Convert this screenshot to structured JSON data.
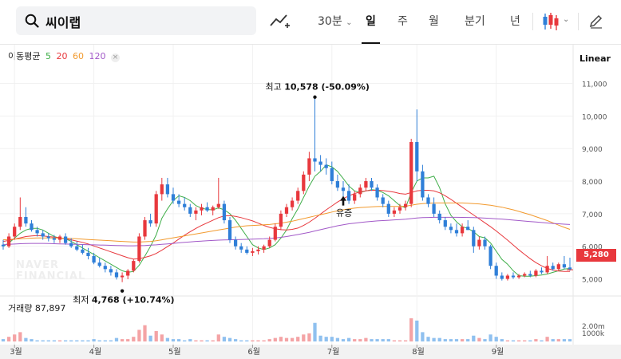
{
  "search": {
    "query": "씨이랩",
    "icon": "search-icon"
  },
  "toolbar": {
    "compare_icon": "line-chart-add-icon",
    "interval_label": "30분",
    "tabs": [
      "일",
      "주",
      "월",
      "분기",
      "년"
    ],
    "active_tab": "일",
    "candle_icon": "candlestick-icon",
    "draw_icon": "pencil-icon"
  },
  "ma_legend": {
    "label": "이동평균",
    "items": [
      {
        "period": "5",
        "color": "#3fae49"
      },
      {
        "period": "20",
        "color": "#e8383d"
      },
      {
        "period": "60",
        "color": "#f29a2e"
      },
      {
        "period": "120",
        "color": "#a259c8"
      }
    ],
    "close_icon": "close-icon"
  },
  "scale_label": "Linear",
  "annotations": {
    "high": {
      "label": "최고",
      "value": "10,578",
      "change": "(-50.09%)"
    },
    "low": {
      "label": "최저",
      "value": "4,768",
      "change": "(+10.74%)"
    },
    "event": "유증"
  },
  "current_price": "5,280",
  "watermark": [
    "NAVER",
    "FINANCIAL"
  ],
  "volume": {
    "label": "거래량",
    "value": "87,897",
    "ticks": [
      "2.00m",
      "1000k"
    ]
  },
  "chart_data": {
    "type": "candlestick",
    "y_ticks": [
      "11,000",
      "10,000",
      "9,000",
      "8,000",
      "7,000",
      "6,000",
      "5,000"
    ],
    "ylim": [
      4500,
      11600
    ],
    "x_labels": [
      "3월",
      "4월",
      "5월",
      "6월",
      "7월",
      "8월",
      "9월"
    ],
    "grid": true,
    "colors": {
      "up": "#e8383d",
      "down": "#2f7fd8"
    },
    "ohlc": [
      [
        6050,
        6200,
        5900,
        6000
      ],
      [
        6000,
        6400,
        5950,
        6300
      ],
      [
        6300,
        6700,
        6200,
        6600
      ],
      [
        6600,
        7500,
        6500,
        6900
      ],
      [
        6900,
        7200,
        6600,
        6700
      ],
      [
        6700,
        6800,
        6450,
        6500
      ],
      [
        6500,
        6600,
        6300,
        6400
      ],
      [
        6400,
        6500,
        6200,
        6300
      ],
      [
        6300,
        6400,
        6150,
        6250
      ],
      [
        6250,
        6350,
        6100,
        6200
      ],
      [
        6200,
        6350,
        6100,
        6300
      ],
      [
        6300,
        6400,
        6050,
        6100
      ],
      [
        6100,
        6250,
        5950,
        6000
      ],
      [
        6000,
        6150,
        5850,
        5900
      ],
      [
        5900,
        6050,
        5750,
        5800
      ],
      [
        5800,
        5950,
        5600,
        5700
      ],
      [
        5700,
        5800,
        5450,
        5500
      ],
      [
        5500,
        5650,
        5350,
        5400
      ],
      [
        5400,
        5500,
        5200,
        5300
      ],
      [
        5300,
        5400,
        5100,
        5200
      ],
      [
        5200,
        5300,
        4980,
        5050
      ],
      [
        5050,
        5200,
        4900,
        5100
      ],
      [
        5100,
        5300,
        4990,
        5250
      ],
      [
        5250,
        5600,
        5200,
        5550
      ],
      [
        5550,
        6400,
        5500,
        6300
      ],
      [
        6300,
        6900,
        6200,
        6800
      ],
      [
        6800,
        7000,
        6600,
        6700
      ],
      [
        6700,
        7700,
        6600,
        7600
      ],
      [
        7600,
        8100,
        7400,
        7900
      ],
      [
        7900,
        8100,
        7500,
        7600
      ],
      [
        7600,
        7800,
        7300,
        7400
      ],
      [
        7400,
        7600,
        7200,
        7300
      ],
      [
        7300,
        7500,
        7100,
        7200
      ],
      [
        7200,
        7300,
        6900,
        7000
      ],
      [
        7000,
        7200,
        6800,
        7100
      ],
      [
        7100,
        7300,
        6950,
        7200
      ],
      [
        7200,
        7350,
        7050,
        7100
      ],
      [
        7100,
        7250,
        6950,
        7200
      ],
      [
        7200,
        8100,
        7150,
        7300
      ],
      [
        7300,
        7400,
        6700,
        6800
      ],
      [
        6800,
        6900,
        6100,
        6200
      ],
      [
        6200,
        6300,
        5900,
        6000
      ],
      [
        6000,
        6100,
        5800,
        5900
      ],
      [
        5900,
        6000,
        5750,
        5800
      ],
      [
        5800,
        5950,
        5700,
        5850
      ],
      [
        5850,
        6000,
        5750,
        5900
      ],
      [
        5900,
        6050,
        5800,
        6000
      ],
      [
        6000,
        6300,
        5950,
        6200
      ],
      [
        6200,
        6700,
        6150,
        6600
      ],
      [
        6600,
        7100,
        6500,
        7000
      ],
      [
        7000,
        7300,
        6900,
        7200
      ],
      [
        7200,
        7500,
        7100,
        7400
      ],
      [
        7400,
        7800,
        7300,
        7700
      ],
      [
        7700,
        8300,
        7600,
        8200
      ],
      [
        8200,
        8900,
        8000,
        8700
      ],
      [
        8700,
        10578,
        8300,
        8600
      ],
      [
        8600,
        8800,
        8300,
        8500
      ],
      [
        8500,
        8700,
        8200,
        8400
      ],
      [
        8400,
        8600,
        7900,
        8000
      ],
      [
        8000,
        8200,
        7700,
        7800
      ],
      [
        7800,
        8000,
        7500,
        7700
      ],
      [
        7700,
        7900,
        7300,
        7400
      ],
      [
        7400,
        7700,
        7300,
        7600
      ],
      [
        7600,
        7900,
        7500,
        7800
      ],
      [
        7800,
        8100,
        7700,
        8000
      ],
      [
        8000,
        8100,
        7700,
        7800
      ],
      [
        7800,
        7900,
        7400,
        7500
      ],
      [
        7500,
        7600,
        7200,
        7300
      ],
      [
        7300,
        7400,
        6900,
        7000
      ],
      [
        7000,
        7200,
        6900,
        7100
      ],
      [
        7100,
        7300,
        7000,
        7200
      ],
      [
        7200,
        7400,
        7100,
        7300
      ],
      [
        7300,
        9300,
        7200,
        9200
      ],
      [
        9200,
        10200,
        8000,
        8300
      ],
      [
        8300,
        8500,
        7400,
        7500
      ],
      [
        7500,
        7600,
        7200,
        7300
      ],
      [
        7300,
        7500,
        6900,
        7000
      ],
      [
        7000,
        7100,
        6700,
        6800
      ],
      [
        6800,
        6900,
        6500,
        6600
      ],
      [
        6600,
        6700,
        6400,
        6500
      ],
      [
        6500,
        6700,
        6300,
        6400
      ],
      [
        6400,
        6700,
        6300,
        6600
      ],
      [
        6600,
        6800,
        6500,
        6500
      ],
      [
        6500,
        6600,
        5800,
        6000
      ],
      [
        6000,
        6300,
        5900,
        6200
      ],
      [
        6200,
        6300,
        5900,
        6000
      ],
      [
        6000,
        6050,
        5300,
        5400
      ],
      [
        5400,
        5500,
        5000,
        5100
      ],
      [
        5100,
        5200,
        4950,
        5000
      ],
      [
        5000,
        5150,
        4950,
        5100
      ],
      [
        5100,
        5200,
        5000,
        5050
      ],
      [
        5050,
        5150,
        5000,
        5100
      ],
      [
        5100,
        5200,
        5050,
        5150
      ],
      [
        5150,
        5250,
        5050,
        5100
      ],
      [
        5100,
        5300,
        5050,
        5250
      ],
      [
        5250,
        5350,
        5150,
        5200
      ],
      [
        5200,
        5700,
        5150,
        5400
      ],
      [
        5400,
        5500,
        5250,
        5300
      ],
      [
        5300,
        5500,
        5250,
        5450
      ],
      [
        5450,
        5700,
        5300,
        5350
      ],
      [
        5350,
        5650,
        5250,
        5280
      ]
    ],
    "volume": [
      0.2,
      0.4,
      0.6,
      0.8,
      0.3,
      0.2,
      0.1,
      0.1,
      0.1,
      0.1,
      0.1,
      0.1,
      0.1,
      0.1,
      0.1,
      0.1,
      0.2,
      0.1,
      0.1,
      0.1,
      0.3,
      0.2,
      0.2,
      0.4,
      1.0,
      1.4,
      0.5,
      0.9,
      0.6,
      0.3,
      0.2,
      0.2,
      0.1,
      0.2,
      0.1,
      0.1,
      0.1,
      0.1,
      0.6,
      0.4,
      0.3,
      0.2,
      0.1,
      0.1,
      0.1,
      0.1,
      0.1,
      0.2,
      0.3,
      0.4,
      0.3,
      0.3,
      0.4,
      0.6,
      0.7,
      1.6,
      0.5,
      0.4,
      0.4,
      0.3,
      0.2,
      0.3,
      0.2,
      0.2,
      0.3,
      0.2,
      0.2,
      0.2,
      0.2,
      0.1,
      0.1,
      0.1,
      2.0,
      1.8,
      0.8,
      0.4,
      0.3,
      0.3,
      0.2,
      0.2,
      0.2,
      0.2,
      0.2,
      0.5,
      0.3,
      0.2,
      0.6,
      0.4,
      0.2,
      0.1,
      0.1,
      0.1,
      0.1,
      0.1,
      0.2,
      0.1,
      0.4,
      0.2,
      0.2,
      0.2,
      0.2
    ],
    "ma5": [
      6000,
      6100,
      6250,
      6400,
      6500,
      6550,
      6550,
      6500,
      6400,
      6300,
      6250,
      6230,
      6150,
      6050,
      5950,
      5850,
      5750,
      5650,
      5550,
      5450,
      5350,
      5250,
      5200,
      5230,
      5420,
      5700,
      6000,
      6350,
      6860,
      7150,
      7400,
      7550,
      7500,
      7400,
      7250,
      7170,
      7130,
      7120,
      7180,
      7120,
      7000,
      6800,
      6550,
      6300,
      6050,
      5950,
      5900,
      5950,
      6050,
      6250,
      6500,
      6850,
      7150,
      7500,
      7850,
      8150,
      8300,
      8500,
      8440,
      8300,
      8080,
      7850,
      7700,
      7650,
      7700,
      7740,
      7720,
      7650,
      7550,
      7400,
      7250,
      7180,
      7650,
      8000,
      8100,
      8100,
      8150,
      7800,
      7300,
      6950,
      6750,
      6600,
      6550,
      6450,
      6300,
      6260,
      6100,
      5850,
      5600,
      5450,
      5250,
      5100,
      5080,
      5080,
      5100,
      5120,
      5150,
      5200,
      5250,
      5300,
      5320
    ],
    "ma20": [
      6150,
      6180,
      6220,
      6260,
      6300,
      6320,
      6330,
      6320,
      6300,
      6280,
      6260,
      6230,
      6200,
      6160,
      6120,
      6070,
      6010,
      5950,
      5890,
      5830,
      5770,
      5710,
      5650,
      5610,
      5620,
      5660,
      5710,
      5780,
      5880,
      5990,
      6100,
      6220,
      6340,
      6450,
      6550,
      6640,
      6720,
      6800,
      6880,
      6930,
      6940,
      6920,
      6880,
      6830,
      6780,
      6710,
      6640,
      6580,
      6540,
      6510,
      6500,
      6520,
      6560,
      6640,
      6740,
      6860,
      6990,
      7120,
      7240,
      7360,
      7460,
      7550,
      7620,
      7670,
      7700,
      7720,
      7720,
      7710,
      7690,
      7660,
      7620,
      7600,
      7650,
      7700,
      7720,
      7720,
      7700,
      7640,
      7550,
      7440,
      7320,
      7200,
      7080,
      6960,
      6840,
      6720,
      6600,
      6470,
      6330,
      6190,
      6040,
      5890,
      5750,
      5620,
      5500,
      5400,
      5320,
      5270,
      5240,
      5230,
      5230
    ],
    "ma60": [
      6200,
      6210,
      6220,
      6230,
      6240,
      6250,
      6255,
      6258,
      6258,
      6255,
      6250,
      6245,
      6240,
      6230,
      6220,
      6210,
      6200,
      6190,
      6180,
      6170,
      6160,
      6150,
      6140,
      6130,
      6130,
      6140,
      6150,
      6170,
      6200,
      6230,
      6260,
      6290,
      6320,
      6350,
      6380,
      6410,
      6440,
      6470,
      6500,
      6530,
      6560,
      6590,
      6610,
      6630,
      6640,
      6650,
      6660,
      6670,
      6690,
      6710,
      6740,
      6770,
      6810,
      6850,
      6890,
      6930,
      6970,
      7010,
      7050,
      7090,
      7120,
      7150,
      7170,
      7190,
      7200,
      7210,
      7220,
      7225,
      7225,
      7225,
      7225,
      7230,
      7260,
      7290,
      7310,
      7320,
      7330,
      7330,
      7330,
      7330,
      7330,
      7330,
      7320,
      7310,
      7300,
      7280,
      7260,
      7230,
      7200,
      7160,
      7120,
      7070,
      7020,
      6970,
      6910,
      6850,
      6790,
      6720,
      6650,
      6580,
      6520
    ],
    "ma120": [
      6050,
      6060,
      6070,
      6080,
      6085,
      6090,
      6090,
      6090,
      6085,
      6080,
      6075,
      6070,
      6065,
      6060,
      6055,
      6050,
      6045,
      6040,
      6035,
      6030,
      6025,
      6020,
      6015,
      6015,
      6020,
      6025,
      6035,
      6045,
      6060,
      6075,
      6090,
      6105,
      6120,
      6135,
      6150,
      6160,
      6170,
      6180,
      6190,
      6195,
      6200,
      6205,
      6210,
      6215,
      6220,
      6225,
      6230,
      6240,
      6255,
      6275,
      6300,
      6330,
      6360,
      6395,
      6430,
      6470,
      6510,
      6550,
      6590,
      6630,
      6660,
      6690,
      6710,
      6730,
      6750,
      6765,
      6780,
      6790,
      6800,
      6810,
      6820,
      6830,
      6850,
      6870,
      6880,
      6885,
      6890,
      6890,
      6890,
      6890,
      6890,
      6888,
      6885,
      6880,
      6875,
      6865,
      6855,
      6845,
      6835,
      6820,
      6805,
      6790,
      6775,
      6760,
      6745,
      6730,
      6715,
      6700,
      6690,
      6680,
      6670
    ]
  }
}
